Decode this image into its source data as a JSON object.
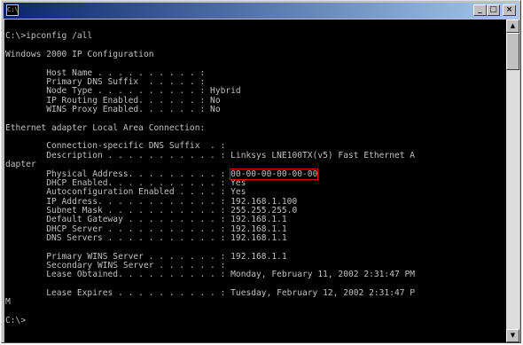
{
  "window": {
    "icon_label": "C:\\",
    "minimize_glyph": "_",
    "maximize_glyph": "□",
    "close_glyph": "×"
  },
  "console": {
    "lines": [
      "",
      "C:\\>ipconfig /all",
      "",
      "Windows 2000 IP Configuration",
      "",
      "        Host Name . . . . . . . . . . :",
      "        Primary DNS Suffix  . . . . . :",
      "        Node Type . . . . . . . . . . : Hybrid",
      "        IP Routing Enabled. . . . . . : No",
      "        WINS Proxy Enabled. . . . . . : No",
      "",
      "Ethernet adapter Local Area Connection:",
      "",
      "        Connection-specific DNS Suffix  . :",
      "        Description . . . . . . . . . . . : Linksys LNE100TX(v5) Fast Ethernet A",
      "dapter",
      "        Physical Address. . . . . . . . . : 00-00-00-00-00-00",
      "        DHCP Enabled. . . . . . . . . . . : Yes",
      "        Autoconfiguration Enabled . . . . : Yes",
      "        IP Address. . . . . . . . . . . . : 192.168.1.100",
      "        Subnet Mask . . . . . . . . . . . : 255.255.255.0",
      "        Default Gateway . . . . . . . . . : 192.168.1.1",
      "        DHCP Server . . . . . . . . . . . : 192.168.1.1",
      "        DNS Servers . . . . . . . . . . . : 192.168.1.1",
      "",
      "        Primary WINS Server . . . . . . . : 192.168.1.1",
      "        Secondary WINS Server . . . . . . :",
      "        Lease Obtained. . . . . . . . . . : Monday, February 11, 2002 2:31:47 PM",
      "",
      "        Lease Expires . . . . . . . . . . : Tuesday, February 12, 2002 2:31:47 P",
      "M",
      "",
      "C:\\>"
    ],
    "highlight": {
      "line_index": 16,
      "prefix": "        Physical Address. . . . . . . . . : ",
      "text": "00-00-00-00-00-00"
    },
    "text_color": "#c0c0c0",
    "background_color": "#000000",
    "highlight_color": "#e00000"
  },
  "colors": {
    "titlebar_start": "#0a246a",
    "titlebar_end": "#a6caf0",
    "chrome": "#c0c0c0"
  }
}
